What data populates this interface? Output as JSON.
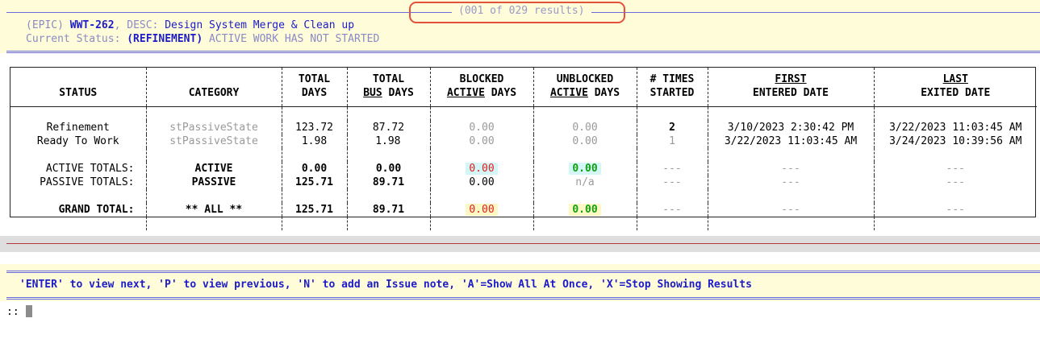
{
  "header": {
    "results_counter": "(001 of 029 results)",
    "line1": {
      "prefix": "(EPIC)",
      "key": "WWT-262",
      "desc_label": ", DESC:",
      "desc": "Design System Merge & Clean up"
    },
    "line2": {
      "label": "Current Status:",
      "status": "(REFINEMENT)",
      "note": "ACTIVE WORK HAS NOT STARTED"
    }
  },
  "table": {
    "headers": {
      "status": "STATUS",
      "category": "CATEGORY",
      "total_days": [
        "TOTAL",
        "DAYS"
      ],
      "total_bus_days": [
        "TOTAL",
        "BUS",
        "DAYS"
      ],
      "blocked_active_days": [
        "BLOCKED",
        "ACTIVE",
        "DAYS"
      ],
      "unblocked_active_days": [
        "UNBLOCKED",
        "ACTIVE",
        "DAYS"
      ],
      "times_started": [
        "# TIMES",
        "STARTED"
      ],
      "first_entered": [
        "FIRST",
        "ENTERED DATE"
      ],
      "last_exited": [
        "LAST",
        "EXITED DATE"
      ]
    },
    "rows": [
      {
        "status": "Refinement",
        "category": "stPassiveState",
        "total_days": "123.72",
        "bus_days": "87.72",
        "blocked": "0.00",
        "unblocked": "0.00",
        "times": "2",
        "first": "3/10/2023 2:30:42 PM",
        "last": "3/22/2023 11:03:45 AM"
      },
      {
        "status": "Ready To Work",
        "category": "stPassiveState",
        "total_days": "1.98",
        "bus_days": "1.98",
        "blocked": "0.00",
        "unblocked": "0.00",
        "times": "1",
        "first": "3/22/2023 11:03:45 AM",
        "last": "3/24/2023 10:39:56 AM"
      }
    ],
    "active_totals": {
      "label": "ACTIVE TOTALS:",
      "category": "ACTIVE",
      "total_days": "0.00",
      "bus_days": "0.00",
      "blocked": "0.00",
      "unblocked": "0.00",
      "times": "---",
      "first": "---",
      "last": "---"
    },
    "passive_totals": {
      "label": "PASSIVE TOTALS:",
      "category": "PASSIVE",
      "total_days": "125.71",
      "bus_days": "89.71",
      "blocked": "0.00",
      "unblocked": "n/a",
      "times": "---",
      "first": "---",
      "last": "---"
    },
    "grand_total": {
      "label": "GRAND TOTAL:",
      "category": "** ALL **",
      "total_days": "125.71",
      "bus_days": "89.71",
      "blocked": "0.00",
      "unblocked": "0.00",
      "times": "---",
      "first": "---",
      "last": "---"
    }
  },
  "footer": {
    "help": "'ENTER' to view next, 'P' to view previous, 'N' to add an Issue note, 'A'=Show All At Once, 'X'=Stop Showing Results",
    "prompt": "::"
  },
  "colors": {
    "header_bg": "#fffcd9",
    "rule_blue": "#6a6adf",
    "highlight_red": "#e4523b",
    "value_red": "#e02020",
    "value_green": "#10a010",
    "cyan_bg": "#d4f6f6",
    "yellow_bg": "#fbf8c4"
  }
}
